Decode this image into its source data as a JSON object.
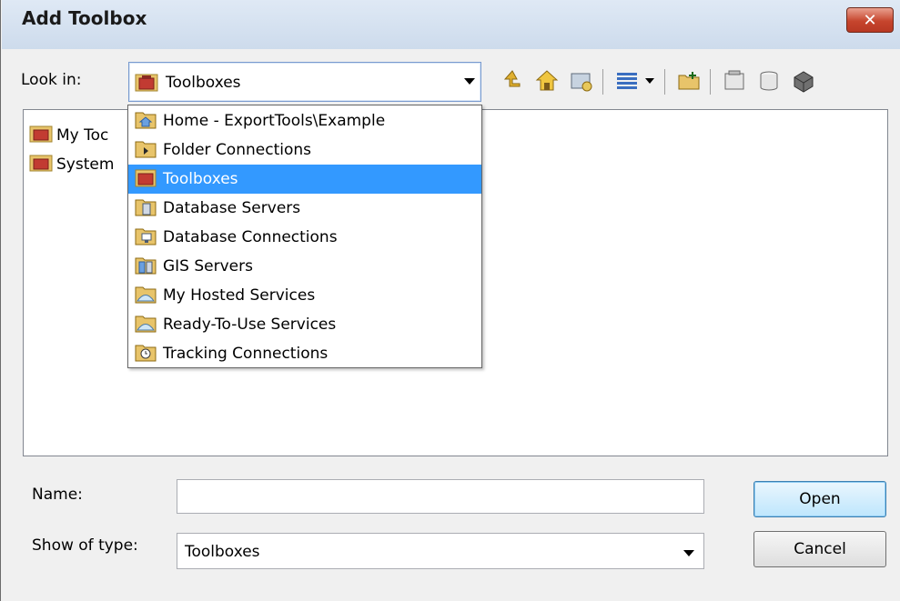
{
  "window": {
    "title": "Add Toolbox",
    "close_label": "✕"
  },
  "lookin": {
    "label": "Look in:",
    "selected": "Toolboxes",
    "options": [
      {
        "label": "Home - ExportTools\\Example",
        "icon": "home-folder-icon"
      },
      {
        "label": "Folder Connections",
        "icon": "folder-connections-icon"
      },
      {
        "label": "Toolboxes",
        "icon": "toolbox-icon",
        "selected": true
      },
      {
        "label": "Database Servers",
        "icon": "database-server-icon"
      },
      {
        "label": "Database Connections",
        "icon": "database-connection-icon"
      },
      {
        "label": "GIS Servers",
        "icon": "gis-server-icon"
      },
      {
        "label": "My Hosted Services",
        "icon": "hosted-services-icon"
      },
      {
        "label": "Ready-To-Use Services",
        "icon": "ready-services-icon"
      },
      {
        "label": "Tracking Connections",
        "icon": "tracking-connection-icon"
      }
    ]
  },
  "toolbar": {
    "icons": [
      "up-one-level-icon",
      "home-icon",
      "connect-folder-icon",
      "view-menu-icon",
      "new-folder-icon",
      "new-toolbox-icon",
      "new-geodatabase-icon",
      "new-item-icon"
    ]
  },
  "content": {
    "items": [
      {
        "label": "My Toolboxes",
        "visible_label": "My Toc"
      },
      {
        "label": "System Toolboxes",
        "visible_label": "System"
      }
    ]
  },
  "name_field": {
    "label": "Name:",
    "value": ""
  },
  "type_field": {
    "label": "Show of type:",
    "selected": "Toolboxes"
  },
  "buttons": {
    "open": "Open",
    "cancel": "Cancel"
  },
  "colors": {
    "selection": "#3399ff",
    "title_bar": "#dfe9f5",
    "close_button": "#c6452d"
  }
}
